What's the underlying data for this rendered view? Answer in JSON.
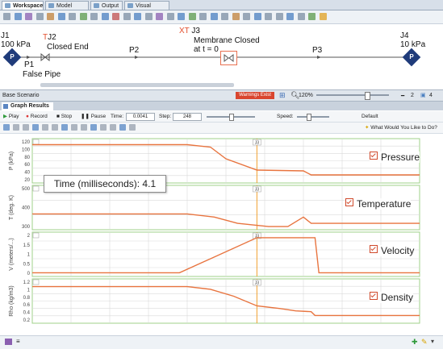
{
  "tabs": [
    {
      "label": "Workspace"
    },
    {
      "label": "Model Data"
    },
    {
      "label": "Output"
    },
    {
      "label": "Visual Report"
    }
  ],
  "model": {
    "j1": {
      "name": "J1",
      "value": "100 kPa",
      "tag": "P"
    },
    "j2": {
      "prefix": "T",
      "name": "J2",
      "desc": "Closed End"
    },
    "p1": {
      "name": "P1",
      "desc": "False Pipe"
    },
    "p2": {
      "name": "P2"
    },
    "j3": {
      "prefix": "XT",
      "name": "J3",
      "desc_line1": "Membrane Closed",
      "desc_line2": "at t = 0"
    },
    "p3": {
      "name": "P3"
    },
    "j4": {
      "name": "J4",
      "value": "10 kPa",
      "tag": "P"
    }
  },
  "status": {
    "scenario": "Base Scenario",
    "warning": "Warnings Exist",
    "zoom": "120%",
    "count_a": "2",
    "count_b": "4"
  },
  "graph_tab": {
    "label": "Graph Results"
  },
  "controls": {
    "play": "Play",
    "record": "Record",
    "stop": "Stop",
    "pause": "Pause",
    "time_label": "Time:",
    "time_value": "0.0041",
    "step_label": "Step:",
    "step_value": "248",
    "speed_label": "Speed:",
    "default_label": "Default",
    "help_label": "What Would You Like to Do?"
  },
  "time_readout": "Time (milliseconds): 4.1",
  "colors": {
    "curve": "#e8743f",
    "cursor": "#f0a030",
    "panel_border": "#9fd08a",
    "grid": "#d9d9d9"
  },
  "chart_data": [
    {
      "type": "line",
      "legend": "Pressure",
      "ylabel": "P (kPa)",
      "yticks": [
        "120",
        "100",
        "80",
        "60",
        "40",
        "20"
      ],
      "ylim": [
        10,
        120
      ],
      "x": [
        0,
        0.4,
        0.46,
        0.5,
        0.58,
        0.7,
        0.72,
        1.0
      ],
      "y": [
        105,
        105,
        99,
        70,
        42,
        40,
        30,
        30
      ],
      "marker_x": 0.58,
      "marker_label": "J3"
    },
    {
      "type": "line",
      "legend": "Temperature",
      "ylabel": "T (deg. K)",
      "yticks": [
        "500",
        "400",
        "300"
      ],
      "ylim": [
        250,
        530
      ],
      "x": [
        0,
        0.4,
        0.47,
        0.53,
        0.61,
        0.66,
        0.7,
        0.72,
        1.0
      ],
      "y": [
        350,
        350,
        330,
        290,
        270,
        270,
        330,
        290,
        290
      ],
      "marker_x": 0.58,
      "marker_label": "J3"
    },
    {
      "type": "line",
      "legend": "Velocity",
      "ylabel": "V (meters/...)",
      "yticks": [
        "2",
        "1.5",
        "1",
        "0.5",
        "0"
      ],
      "ylim": [
        -0.2,
        2.2
      ],
      "x": [
        0,
        0.38,
        0.58,
        0.73,
        0.74,
        1.0
      ],
      "y": [
        0,
        0,
        1.9,
        1.9,
        0,
        0
      ],
      "marker_x": 0.58,
      "marker_label": "J3"
    },
    {
      "type": "line",
      "legend": "Density",
      "ylabel": "Rho (kg/m3)",
      "yticks": [
        "1.2",
        "1",
        "0.8",
        "0.6",
        "0.4",
        "0.2"
      ],
      "ylim": [
        0.1,
        1.25
      ],
      "x": [
        0,
        0.4,
        0.46,
        0.52,
        0.58,
        0.64,
        0.68,
        0.72,
        0.73,
        1.0
      ],
      "y": [
        1.05,
        1.05,
        0.98,
        0.8,
        0.55,
        0.48,
        0.42,
        0.4,
        0.3,
        0.3
      ],
      "marker_x": 0.58,
      "marker_label": "J3"
    }
  ]
}
